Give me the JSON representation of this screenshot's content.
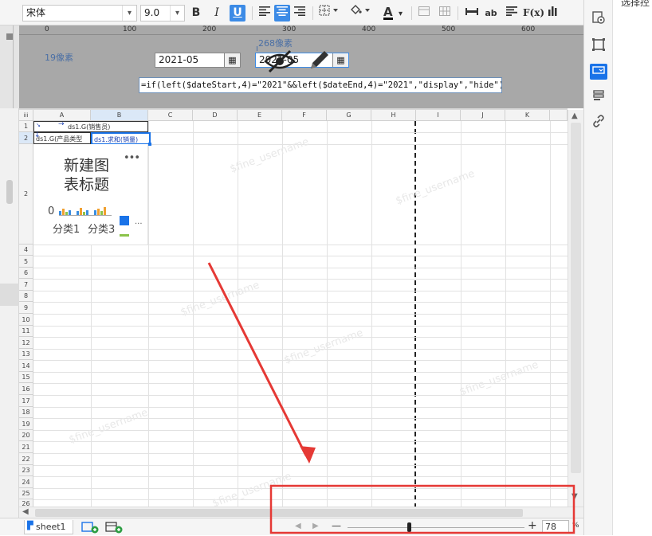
{
  "toolbar": {
    "font_name": "宋体",
    "font_size": "9.0",
    "bold": "B",
    "italic": "I",
    "underline": "U",
    "text_color_letter": "A",
    "ab_label": "ab",
    "fx_label": "F(x)"
  },
  "design": {
    "ruler_ticks": [
      "0",
      "100",
      "200",
      "300",
      "400",
      "500",
      "600"
    ],
    "left_label": "19像素",
    "top_label": "268像素",
    "date_start": "2021-05",
    "date_end": "2021-05",
    "formula": "=if(left($dateStart,4)=\"2021\"&&left($dateEnd,4)=\"2021\",\"display\",\"hide\")"
  },
  "grid": {
    "corner": "iii",
    "columns": [
      "A",
      "B",
      "C",
      "D",
      "E",
      "F",
      "G",
      "H",
      "I",
      "J",
      "K"
    ],
    "rows": [
      "1",
      "2",
      "2",
      "4",
      "5",
      "6",
      "7",
      "8",
      "9",
      "10",
      "11",
      "12",
      "13",
      "14",
      "15",
      "16",
      "17",
      "18",
      "19",
      "20",
      "21",
      "22",
      "23",
      "24",
      "25",
      "26"
    ],
    "a1": "ds1.G(销售员)",
    "a2": "ds1.G(产品类型",
    "b2": "ds1.求和(销量)",
    "chart_title": "新建图表标题",
    "chart_more": "•••",
    "chart_zero": "0",
    "chart_cat1": "分类1",
    "chart_cat3": "分类3",
    "chart_legend_more": "...",
    "watermark": "$fine_username"
  },
  "status": {
    "sheet_name": "sheet1",
    "zoom_minus": "—",
    "zoom_plus": "+",
    "zoom_value": "78",
    "zoom_unit": "%"
  },
  "colors": {
    "accent": "#3c8be6",
    "annotation": "#e53935",
    "selection": "#1a73e8"
  },
  "right_panel": {
    "partial_label": "选择控"
  }
}
